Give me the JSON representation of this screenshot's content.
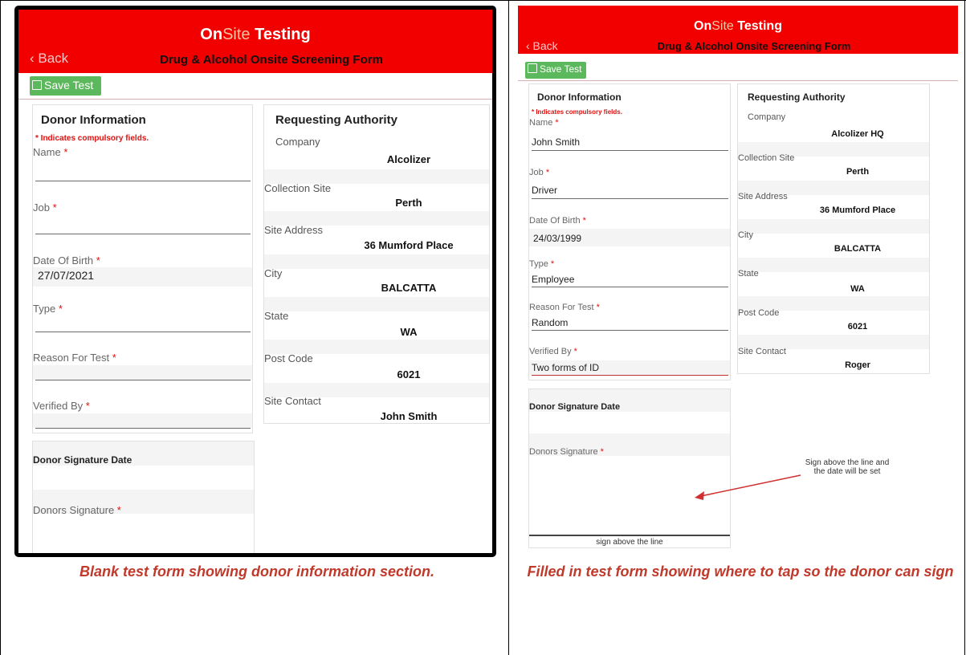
{
  "app": {
    "logo_on": "On",
    "logo_site": "Site",
    "logo_testing": " Testing",
    "back_label": "‹ Back",
    "form_title": "Drug & Alcohol Onsite Screening Form",
    "save_label": "Save Test",
    "save_icon": "floppy-disk-icon"
  },
  "colors": {
    "header_red": "#f20000",
    "save_green": "#5cb85c",
    "required_red": "#e01010",
    "caption_red": "#c0392b"
  },
  "left": {
    "donor": {
      "title": "Donor Information",
      "required_note": "* Indicates compulsory fields.",
      "fields": [
        {
          "label": "Name",
          "value": ""
        },
        {
          "label": "Job",
          "value": ""
        },
        {
          "label": "Date Of Birth",
          "value": "27/07/2021"
        },
        {
          "label": "Type",
          "value": ""
        },
        {
          "label": "Reason For Test",
          "value": ""
        },
        {
          "label": "Verified By",
          "value": ""
        }
      ]
    },
    "signature": {
      "date_label": "Donor Signature Date",
      "sig_label": "Donors Signature"
    },
    "authority": {
      "title": "Requesting Authority",
      "rows": [
        {
          "label": "Company",
          "value": "Alcolizer"
        },
        {
          "label": "Collection Site",
          "value": "Perth"
        },
        {
          "label": "Site Address",
          "value": "36 Mumford Place"
        },
        {
          "label": "City",
          "value": "BALCATTA"
        },
        {
          "label": "State",
          "value": "WA"
        },
        {
          "label": "Post Code",
          "value": "6021"
        },
        {
          "label": "Site Contact",
          "value": "John Smith"
        }
      ]
    },
    "caption": "Blank test form showing donor information section."
  },
  "right": {
    "donor": {
      "title": "Donor Information",
      "required_note": "* Indicates compulsory fields.",
      "fields": [
        {
          "label": "Name",
          "value": "John Smith"
        },
        {
          "label": "Job",
          "value": "Driver"
        },
        {
          "label": "Date Of Birth",
          "value": "24/03/1999"
        },
        {
          "label": "Type",
          "value": "Employee"
        },
        {
          "label": "Reason For Test",
          "value": "Random"
        },
        {
          "label": "Verified By",
          "value": "Two forms of ID"
        }
      ]
    },
    "signature": {
      "date_label": "Donor Signature Date",
      "sig_label": "Donors Signature",
      "sign_line_label": "sign above the line"
    },
    "authority": {
      "title": "Requesting Authority",
      "rows": [
        {
          "label": "Company",
          "value": "Alcolizer HQ"
        },
        {
          "label": "Collection Site",
          "value": "Perth"
        },
        {
          "label": "Site Address",
          "value": "36 Mumford Place"
        },
        {
          "label": "City",
          "value": "BALCATTA"
        },
        {
          "label": "State",
          "value": "WA"
        },
        {
          "label": "Post Code",
          "value": "6021"
        },
        {
          "label": "Site Contact",
          "value": "Roger"
        }
      ]
    },
    "annotation_line1": "Sign above the line and",
    "annotation_line2": "the date will be set",
    "caption": "Filled in test form showing where to tap so the donor can sign"
  }
}
